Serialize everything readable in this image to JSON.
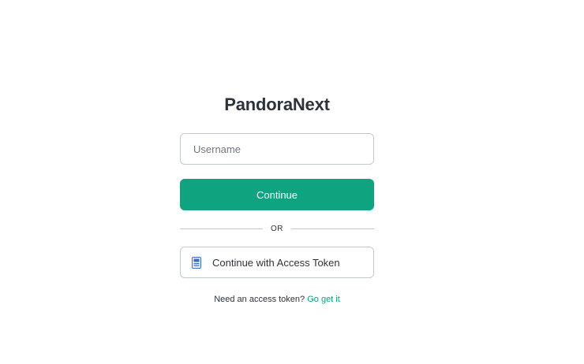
{
  "app": {
    "title": "PandoraNext"
  },
  "login": {
    "username_placeholder": "Username",
    "username_value": "",
    "continue_label": "Continue",
    "divider_label": "OR",
    "token_button_label": "Continue with Access Token",
    "token_button_icon": "token-card-icon"
  },
  "footer": {
    "prompt": "Need an access token?",
    "link_label": "Go get it"
  },
  "colors": {
    "accent": "#10a37f",
    "text": "#2d333a",
    "border": "#c2c8d0",
    "icon_blue": "#3b6fc2"
  }
}
